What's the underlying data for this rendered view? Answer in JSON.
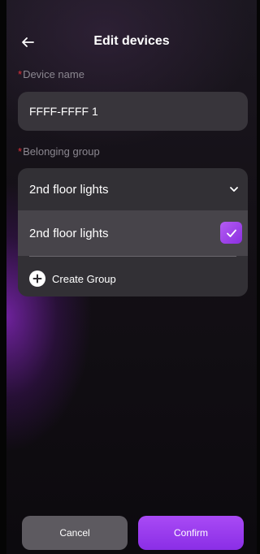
{
  "header": {
    "title": "Edit devices"
  },
  "device_name": {
    "required_mark": "*",
    "label": "Device name",
    "value": "FFFF-FFFF 1"
  },
  "group": {
    "required_mark": "*",
    "label": "Belonging group",
    "selected": "2nd floor lights",
    "options": [
      {
        "label": "2nd floor lights",
        "checked": true
      }
    ],
    "create_label": "Create Group"
  },
  "footer": {
    "cancel_label": "Cancel",
    "confirm_label": "Confirm"
  },
  "colors": {
    "accent": "#9b3cf0",
    "required": "#e0313a"
  }
}
